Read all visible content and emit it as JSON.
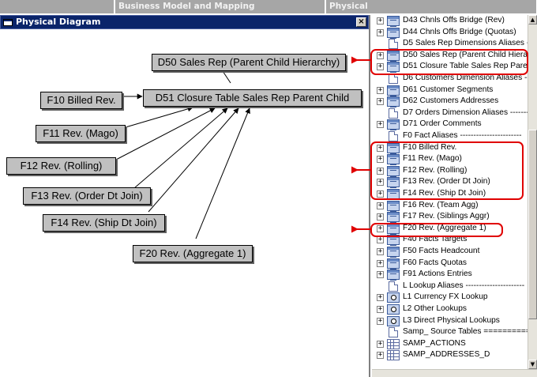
{
  "tabs": [
    "",
    "Business Model and Mapping",
    "Physical"
  ],
  "diagram": {
    "title": "Physical Diagram",
    "close_glyph": "×",
    "nodes": {
      "d50": "D50 Sales Rep (Parent Child Hierarchy)",
      "d51": "D51 Closure Table Sales Rep Parent Child",
      "f10": "F10 Billed Rev.",
      "f11": "F11 Rev. (Mago)",
      "f12": "F12 Rev. (Rolling)",
      "f13": "F13 Rev. (Order Dt Join)",
      "f14": "F14 Rev. (Ship Dt Join)",
      "f20": "F20 Rev. (Aggregate 1)"
    }
  },
  "tree": {
    "items": [
      {
        "icon": "table-icon",
        "expand": true,
        "label": "D43 Chnls Offs Bridge (Rev)"
      },
      {
        "icon": "table-icon",
        "expand": true,
        "label": "D44 Chnls Offs Bridge (Quotas)"
      },
      {
        "icon": "alias-icon",
        "expand": false,
        "label": "D5 Sales Rep Dimensions Aliases -----"
      },
      {
        "icon": "table-icon",
        "expand": true,
        "label": "D50 Sales Rep (Parent Child Hierarchy)"
      },
      {
        "icon": "table-icon",
        "expand": true,
        "label": "D51 Closure Table Sales Rep Parent Child"
      },
      {
        "icon": "alias-icon",
        "expand": false,
        "label": "D6 Customers Dimension Aliases ------"
      },
      {
        "icon": "table-icon",
        "expand": true,
        "label": "D61 Customer Segments"
      },
      {
        "icon": "table-icon",
        "expand": true,
        "label": "D62 Customers Addresses"
      },
      {
        "icon": "alias-icon",
        "expand": false,
        "label": "D7 Orders Dimension Aliases ---------"
      },
      {
        "icon": "table-icon",
        "expand": true,
        "label": "D71 Order Comments"
      },
      {
        "icon": "alias-icon",
        "expand": false,
        "label": "F0 Fact Aliases -----------------------"
      },
      {
        "icon": "table-icon",
        "expand": true,
        "label": "F10 Billed Rev."
      },
      {
        "icon": "table-icon",
        "expand": true,
        "label": "F11 Rev. (Mago)"
      },
      {
        "icon": "table-icon",
        "expand": true,
        "label": "F12 Rev. (Rolling)"
      },
      {
        "icon": "table-icon",
        "expand": true,
        "label": "F13 Rev. (Order Dt Join)"
      },
      {
        "icon": "table-icon",
        "expand": true,
        "label": "F14 Rev. (Ship Dt Join)"
      },
      {
        "icon": "table-icon",
        "expand": true,
        "label": "F16 Rev. (Team Agg)"
      },
      {
        "icon": "table-icon",
        "expand": true,
        "label": "F17 Rev. (Siblings Aggr)"
      },
      {
        "icon": "table-icon",
        "expand": true,
        "label": "F20 Rev. (Aggregate 1)"
      },
      {
        "icon": "table-icon",
        "expand": true,
        "label": "F40 Facts Targets"
      },
      {
        "icon": "table-icon",
        "expand": true,
        "label": "F50 Facts Headcount"
      },
      {
        "icon": "table-icon",
        "expand": true,
        "label": "F60 Facts Quotas"
      },
      {
        "icon": "table-icon",
        "expand": true,
        "label": "F91 Actions Entries"
      },
      {
        "icon": "alias-icon",
        "expand": false,
        "label": "L Lookup Aliases ----------------------"
      },
      {
        "icon": "lookup-icon",
        "expand": true,
        "label": "L1 Currency FX Lookup"
      },
      {
        "icon": "lookup-icon",
        "expand": true,
        "label": "L2 Other Lookups"
      },
      {
        "icon": "lookup-icon",
        "expand": true,
        "label": "L3 Direct Physical Lookups"
      },
      {
        "icon": "alias-icon",
        "expand": false,
        "label": "Samp_ Source Tables =============="
      },
      {
        "icon": "grid-table-icon",
        "expand": true,
        "label": "SAMP_ACTIONS"
      },
      {
        "icon": "grid-table-icon",
        "expand": true,
        "label": "SAMP_ADDRESSES_D"
      }
    ]
  },
  "colors": {
    "highlight": "#e00000",
    "titlebar": "#0a246a",
    "node_fill": "#c0c0c0"
  }
}
